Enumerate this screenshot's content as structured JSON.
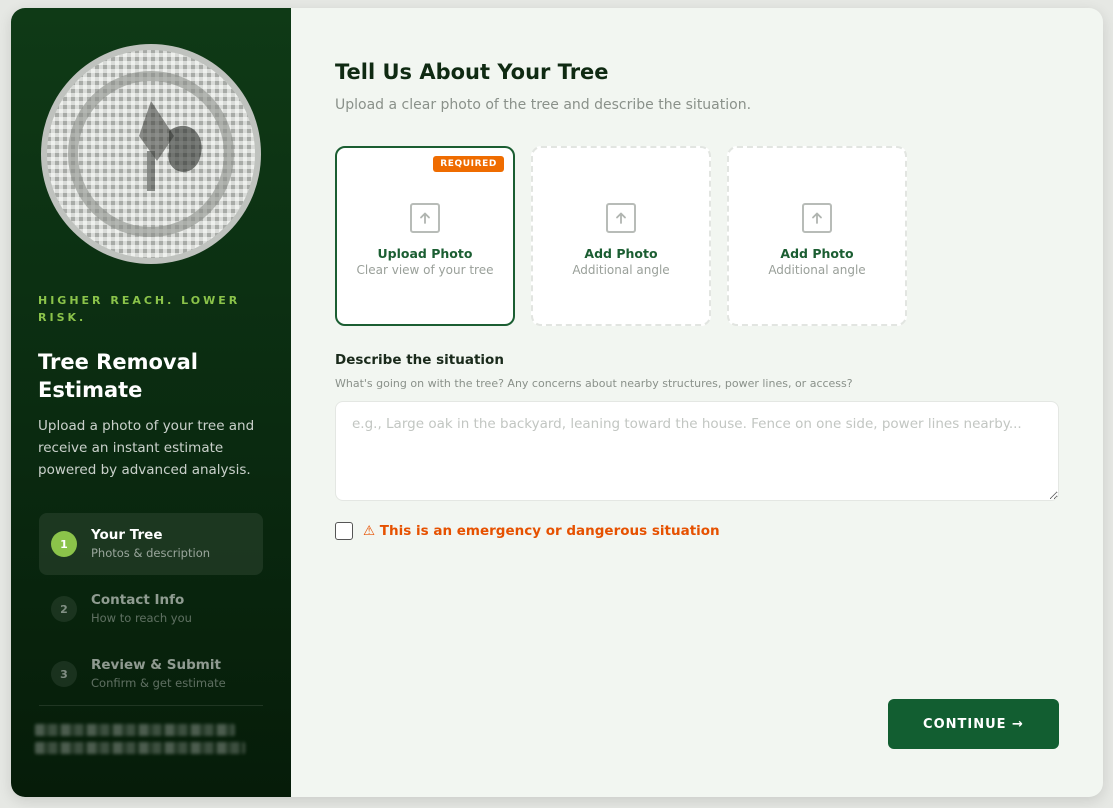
{
  "sidebar": {
    "logo_icon": "tree-seal-logo",
    "tagline": "HIGHER REACH. LOWER RISK.",
    "title": "Tree Removal Estimate",
    "description": "Upload a photo of your tree and receive an instant estimate powered by advanced analysis.",
    "steps": [
      {
        "number": "1",
        "label": "Your Tree",
        "sub": "Photos & description",
        "active": true
      },
      {
        "number": "2",
        "label": "Contact Info",
        "sub": "How to reach you",
        "active": false
      },
      {
        "number": "3",
        "label": "Review & Submit",
        "sub": "Confirm & get estimate",
        "active": false
      }
    ]
  },
  "main": {
    "title": "Tell Us About Your Tree",
    "subtitle": "Upload a clear photo of the tree and describe the situation.",
    "photo_cards": [
      {
        "badge": "REQUIRED",
        "label": "Upload Photo",
        "sub": "Clear view of your tree",
        "icon": "upload-icon"
      },
      {
        "label": "Add Photo",
        "sub": "Additional angle",
        "icon": "upload-icon"
      },
      {
        "label": "Add Photo",
        "sub": "Additional angle",
        "icon": "upload-icon"
      }
    ],
    "describe": {
      "label": "Describe the situation",
      "help": "What's going on with the tree? Any concerns about nearby structures, power lines, or access?",
      "placeholder": "e.g., Large oak in the backyard, leaning toward the house. Fence on one side, power lines nearby...",
      "value": ""
    },
    "emergency": {
      "icon": "warning-icon",
      "text": "⚠ This is an emergency or dangerous situation",
      "checked": false
    },
    "continue_label": "CONTINUE →"
  },
  "colors": {
    "sidebar_bg": "#0a2a10",
    "accent_green": "#8bc34a",
    "primary_green": "#125e31",
    "warning_orange": "#ef6c00"
  }
}
